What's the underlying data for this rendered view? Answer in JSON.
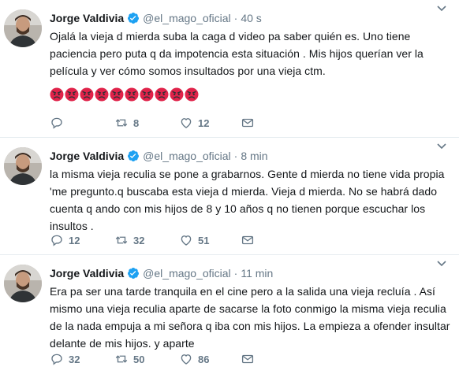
{
  "tweets": [
    {
      "name": "Jorge Valdivia",
      "handle": "@el_mago_oficial",
      "separator": "·",
      "time": "40 s",
      "text": "Ojalá la vieja d mierda suba la caga d video pa saber quién es. Uno tiene paciencia pero puta q da impotencia esta situación . Mis hijos querían ver la película y ver cómo somos insultados por una vieja ctm.",
      "emoji_count": 10,
      "replies": "",
      "retweets": "8",
      "likes": "12"
    },
    {
      "name": "Jorge Valdivia",
      "handle": "@el_mago_oficial",
      "separator": "·",
      "time": "8 min",
      "text": "la misma vieja reculia se pone a grabarnos. Gente d mierda no tiene vida propia 'me pregunto.q buscaba esta vieja d mierda. Vieja d mierda. No se habrá dado cuenta q ando con mis hijos de 8 y 10 años q no tienen porque escuchar los insultos .",
      "replies": "12",
      "retweets": "32",
      "likes": "51"
    },
    {
      "name": "Jorge Valdivia",
      "handle": "@el_mago_oficial",
      "separator": "·",
      "time": "11 min",
      "text": "Era pa ser una tarde tranquila en el cine pero a la salida una vieja recluía . Así mismo una vieja reculia aparte de sacarse la foto conmigo la misma vieja reculia de la nada empuja a mi señora q iba con mis hijos. La empieza a ofender insultar delante de mis hijos. y aparte",
      "replies": "32",
      "retweets": "50",
      "likes": "86"
    }
  ],
  "colors": {
    "text": "#14171a",
    "muted": "#657786",
    "verified": "#1da1f2",
    "divider": "#e6ecf0",
    "emoji": "#e0234a"
  },
  "icons": [
    "verified-badge-icon",
    "chevron-down-icon",
    "reply-icon",
    "retweet-icon",
    "like-icon",
    "direct-message-icon",
    "angry-face-icon"
  ]
}
